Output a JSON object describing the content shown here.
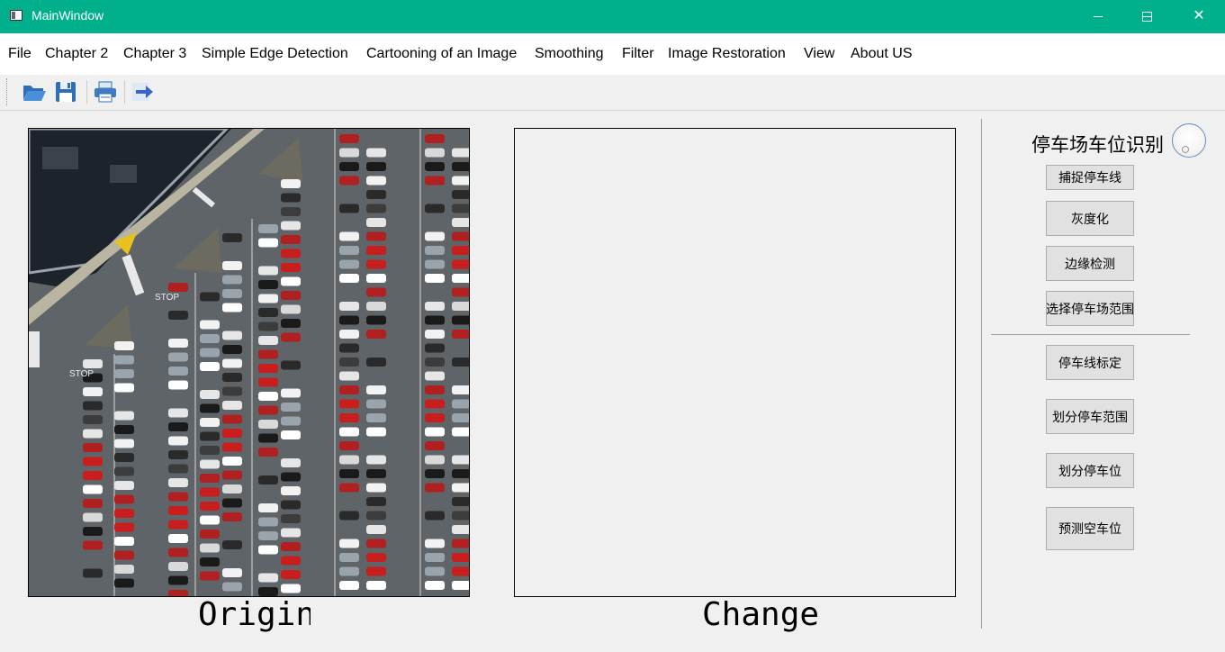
{
  "window": {
    "title": "MainWindow",
    "minimize": "—",
    "maximize": "☐",
    "close": "✕"
  },
  "menu": [
    "File",
    "Chapter 2",
    "Chapter 3",
    "Simple Edge Detection",
    "Cartooning of an Image",
    "Smoothing",
    "Filter",
    "Image Restoration",
    "View",
    "About US"
  ],
  "toolbar": {
    "icons": [
      "open-folder-icon",
      "save-icon",
      "print-icon",
      "export-arrow-icon"
    ]
  },
  "images": {
    "origin_caption": "Origin",
    "changed_caption": "Changed"
  },
  "panel": {
    "title": "停车场车位识别",
    "buttons": [
      "捕捉停车线",
      "灰度化",
      "边缘检测",
      "选择停车场范围",
      "停车线标定",
      "划分停车范围",
      "划分停车位",
      "预测空车位"
    ]
  },
  "colors": {
    "titlebar": "#00b08c",
    "window_bg": "#f0f0f0",
    "button_bg": "#e1e1e1"
  }
}
